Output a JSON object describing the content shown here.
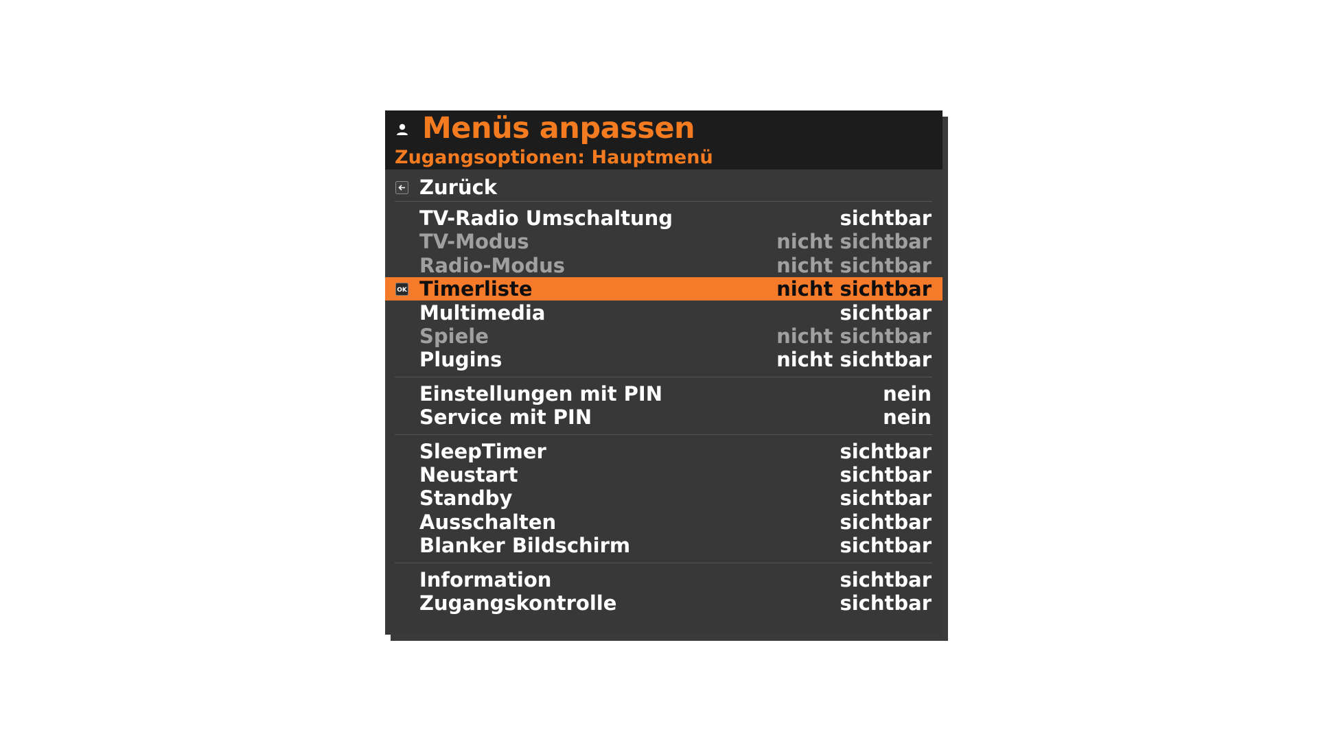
{
  "header": {
    "title": "Menüs anpassen",
    "subtitle": "Zugangsoptionen: Hauptmenü"
  },
  "back": {
    "label": "Zurück"
  },
  "groups": [
    [
      {
        "label": "TV-Radio Umschaltung",
        "value": "sichtbar",
        "state": "normal"
      },
      {
        "label": "TV-Modus",
        "value": "nicht sichtbar",
        "state": "disabled"
      },
      {
        "label": "Radio-Modus",
        "value": "nicht sichtbar",
        "state": "disabled"
      },
      {
        "label": "Timerliste",
        "value": "nicht sichtbar",
        "state": "selected"
      },
      {
        "label": "Multimedia",
        "value": "sichtbar",
        "state": "normal"
      },
      {
        "label": "Spiele",
        "value": "nicht sichtbar",
        "state": "disabled"
      },
      {
        "label": "Plugins",
        "value": "nicht sichtbar",
        "state": "normal"
      }
    ],
    [
      {
        "label": "Einstellungen mit PIN",
        "value": "nein",
        "state": "normal"
      },
      {
        "label": "Service mit PIN",
        "value": "nein",
        "state": "normal"
      }
    ],
    [
      {
        "label": "SleepTimer",
        "value": "sichtbar",
        "state": "normal"
      },
      {
        "label": "Neustart",
        "value": "sichtbar",
        "state": "normal"
      },
      {
        "label": "Standby",
        "value": "sichtbar",
        "state": "normal"
      },
      {
        "label": "Ausschalten",
        "value": "sichtbar",
        "state": "normal"
      },
      {
        "label": "Blanker Bildschirm",
        "value": "sichtbar",
        "state": "normal"
      }
    ],
    [
      {
        "label": "Information",
        "value": "sichtbar",
        "state": "normal"
      },
      {
        "label": "Zugangskontrolle",
        "value": "sichtbar",
        "state": "normal"
      }
    ]
  ],
  "icons": {
    "header": "user-icon",
    "back": "back-arrow-icon",
    "selected": "ok-button-icon"
  },
  "colors": {
    "accent": "#f57b20",
    "panel": "#383838",
    "header": "#1c1c1c",
    "disabled_text": "#a0a0a0",
    "text": "#ffffff"
  }
}
